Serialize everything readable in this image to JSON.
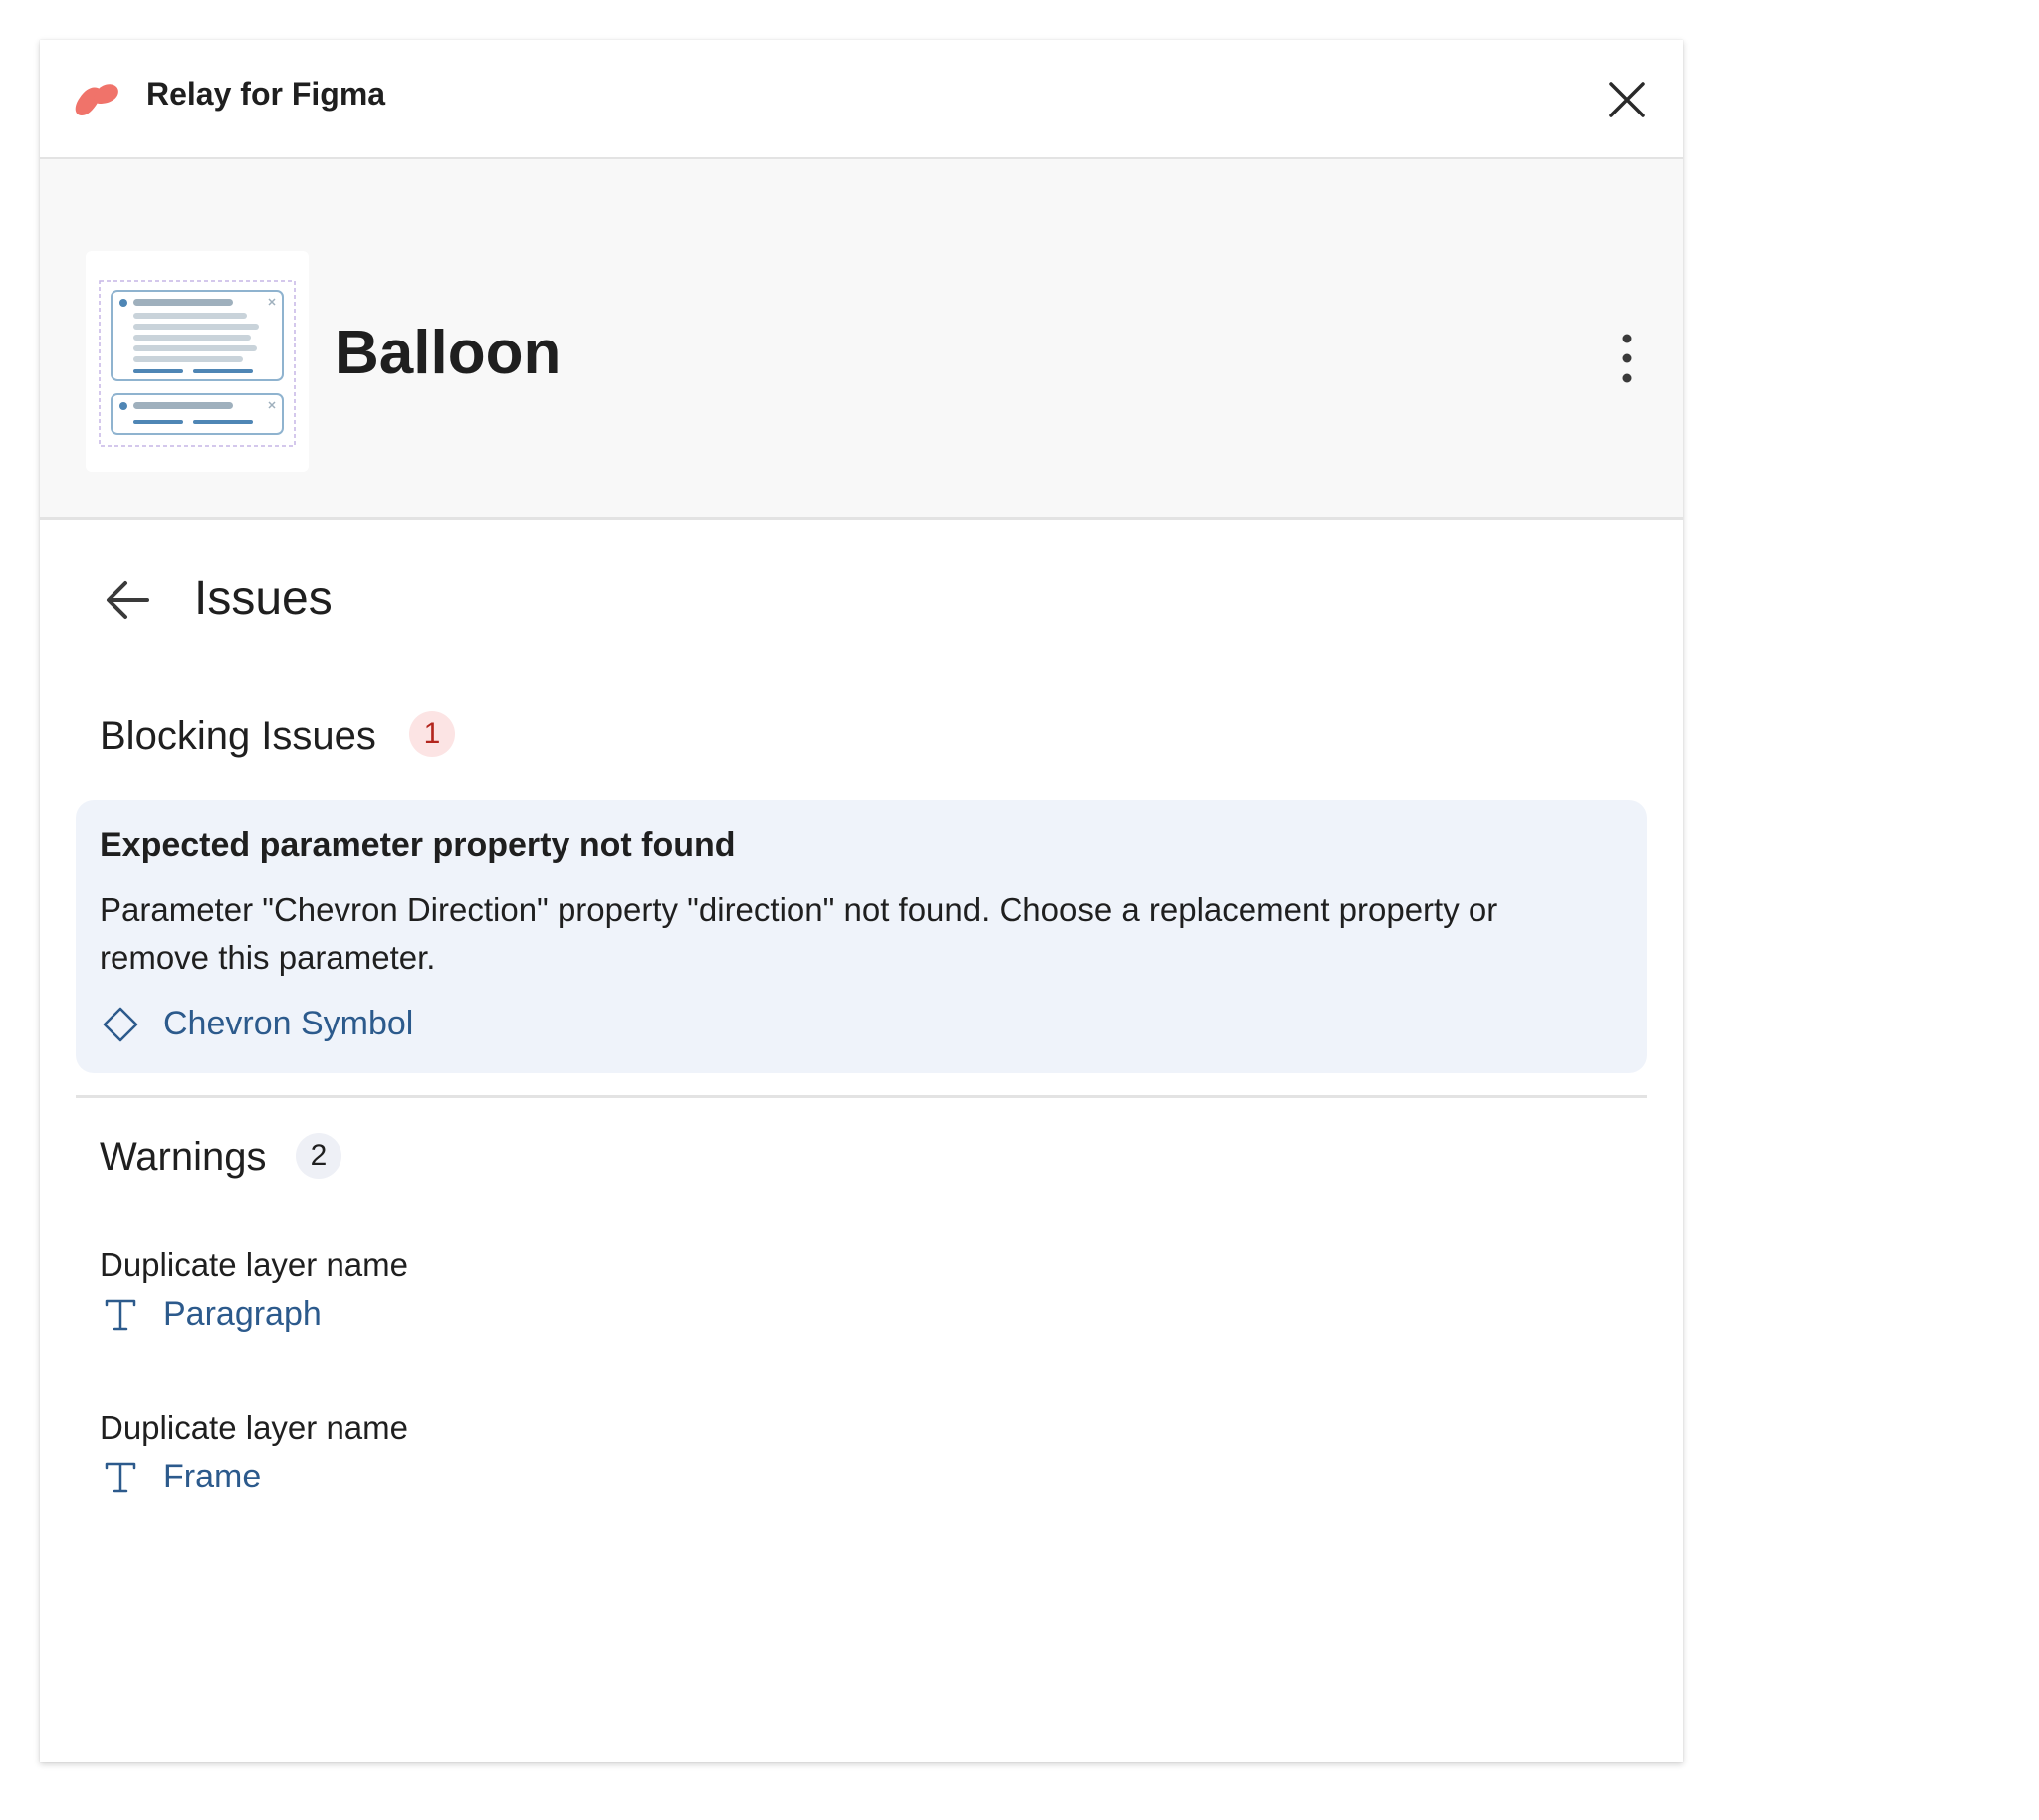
{
  "app": {
    "title": "Relay for Figma",
    "brand_color": "#f0736a"
  },
  "header": {
    "component_name": "Balloon"
  },
  "issues_view": {
    "title": "Issues",
    "blocking": {
      "title": "Blocking Issues",
      "count": "1",
      "items": [
        {
          "heading": "Expected parameter property not found",
          "description": "Parameter \"Chevron Direction\" property \"direction\" not found. Choose a replacement property or remove this parameter.",
          "layer": "Chevron Symbol",
          "layer_icon": "component-diamond-icon"
        }
      ]
    },
    "warnings": {
      "title": "Warnings",
      "count": "2",
      "items": [
        {
          "label": "Duplicate layer name",
          "layer": "Paragraph",
          "layer_icon": "text-layer-icon"
        },
        {
          "label": "Duplicate layer name",
          "layer": "Frame",
          "layer_icon": "text-layer-icon"
        }
      ]
    }
  },
  "colors": {
    "link": "#2c5a8c",
    "error_badge_bg": "#fce4e4",
    "error_badge_text": "#b3261e",
    "card_bg": "#eff3fa"
  }
}
